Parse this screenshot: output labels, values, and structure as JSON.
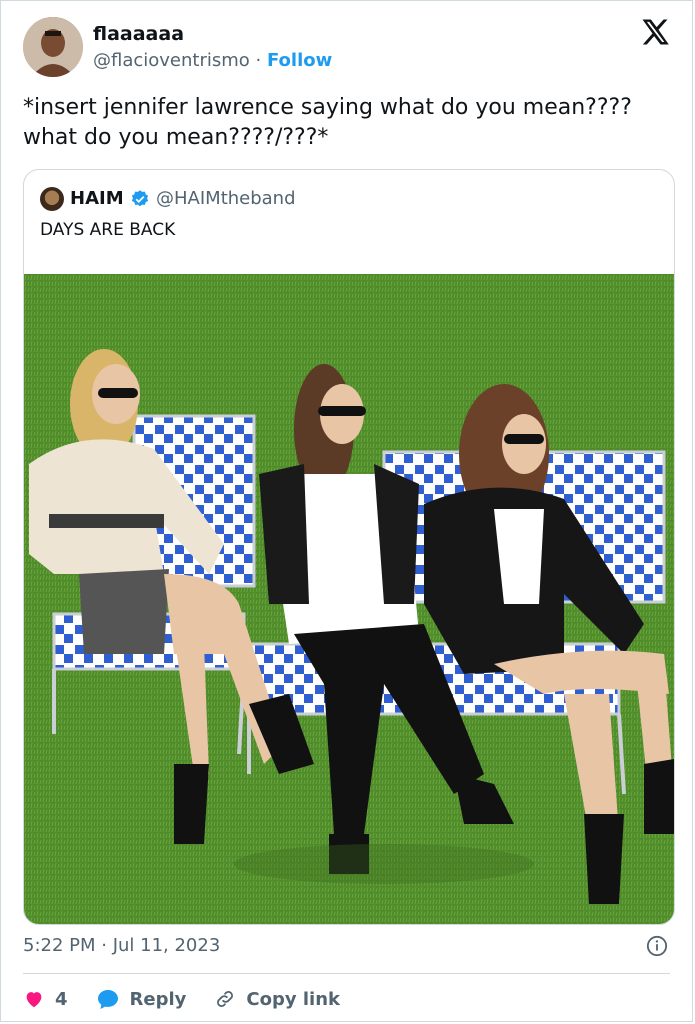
{
  "tweet": {
    "author": {
      "name": "flaaaaaa",
      "handle": "@flacioventrismo",
      "separator": " · ",
      "follow_label": "Follow"
    },
    "text": "*insert jennifer lawrence saying what do you mean???? what do you mean????/???*",
    "logo_icon": "x-logo-icon",
    "quoted": {
      "name": "HAIM",
      "handle": "@HAIMtheband",
      "text": "DAYS ARE BACK",
      "verified_color": "#1d9bf0"
    },
    "timestamp": "5:22 PM · Jul 11, 2023",
    "actions": {
      "like_count": "4",
      "reply_label": "Reply",
      "copy_link_label": "Copy link"
    }
  },
  "colors": {
    "accent": "#1d9bf0",
    "like": "#f91880",
    "text_secondary": "#536471",
    "border": "#cfd9de"
  }
}
